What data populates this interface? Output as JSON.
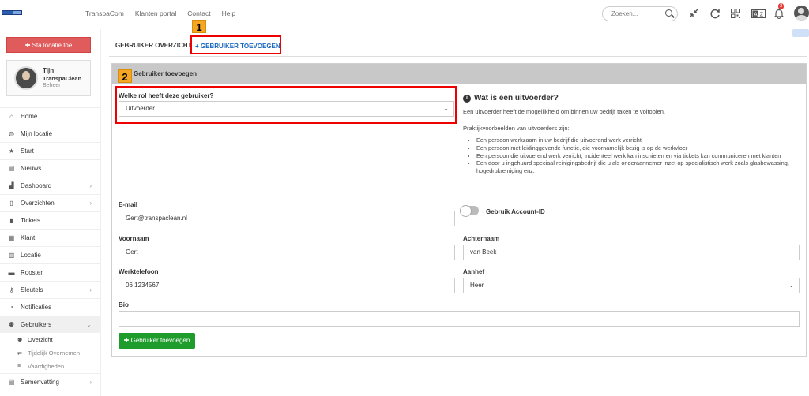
{
  "topbar": {
    "nav": [
      "TranspaCom",
      "Klanten portal",
      "Contact",
      "Help"
    ],
    "search_placeholder": "Zoeken...",
    "notification_count": "2",
    "icons": [
      "compress-icon",
      "refresh-icon",
      "qr-icon",
      "translate-icon",
      "bell-icon"
    ]
  },
  "sidebar": {
    "add_location_button": "✚ Sta locatie toe",
    "profile": {
      "name": "Tijn",
      "org": "TranspaClean",
      "role": "Beheer"
    },
    "items": [
      {
        "label": "Home",
        "icon": "home-icon",
        "glyph": "⌂"
      },
      {
        "label": "Mijn locatie",
        "icon": "globe-icon",
        "glyph": "◍"
      },
      {
        "label": "Start",
        "icon": "star-icon",
        "glyph": "★"
      },
      {
        "label": "Nieuws",
        "icon": "news-icon",
        "glyph": "▤"
      },
      {
        "label": "Dashboard",
        "icon": "chart-icon",
        "glyph": "📈",
        "chevron": true
      },
      {
        "label": "Overzichten",
        "icon": "file-icon",
        "glyph": "▯",
        "chevron": true
      },
      {
        "label": "Tickets",
        "icon": "comment-icon",
        "glyph": "▮"
      },
      {
        "label": "Klant",
        "icon": "building-icon",
        "glyph": "▦"
      },
      {
        "label": "Locatie",
        "icon": "location-building-icon",
        "glyph": "▥"
      },
      {
        "label": "Rooster",
        "icon": "calendar-icon",
        "glyph": "▬"
      },
      {
        "label": "Sleutels",
        "icon": "key-icon",
        "glyph": "⚷",
        "chevron": true
      },
      {
        "label": "Notificaties",
        "icon": "bell-icon",
        "glyph": "🔔"
      },
      {
        "label": "Gebruikers",
        "icon": "users-icon",
        "glyph": "👥",
        "chevron": true
      }
    ],
    "sub_items": [
      {
        "label": "Overzicht",
        "glyph": "👥"
      },
      {
        "label": "Tijdelijk Overnemen",
        "glyph": "⇄"
      },
      {
        "label": "Vaardigheden",
        "glyph": "≡"
      }
    ],
    "last_item": {
      "label": "Samenvatting",
      "glyph": "▤"
    }
  },
  "tabs": {
    "overview": "GEBRUIKER OVERZICHT",
    "add": "+ GEBRUIKER TOEVOEGEN"
  },
  "markers": [
    "1",
    "2"
  ],
  "panel": {
    "title": "Gebruiker toevoegen",
    "role_label": "Welke rol heeft deze gebruiker?",
    "role_value": "Uitvoerder",
    "info": {
      "title": "Wat is een uitvoerder?",
      "intro": "Een uitvoerder heeft de mogelijkheid om binnen uw bedrijf taken te voltooien.",
      "examples_heading": "Praktijkvoorbeelden van uitvoerders zijn:",
      "examples": [
        "Een persoon werkzaam in uw bedrijf die uitvoerend werk verricht",
        "Een persoon met leidinggevende functie, die voornamelijk bezig is op de werkvloer",
        "Een persoon die uitvoerend werk verricht, incidenteel werk kan inschieten en via tickets kan communiceren met klanten",
        "Een door u ingehuurd speciaal reinigingsbedrijf die u als onderaannemer inzet op specialistisch werk zoals glasbewassing, hogedrukreiniging enz."
      ]
    },
    "fields": {
      "email_label": "E-mail",
      "email_value": "Gert@transpaclean.nl",
      "account_toggle_label": "Gebruik Account-ID",
      "firstname_label": "Voornaam",
      "firstname_value": "Gert",
      "lastname_label": "Achternaam",
      "lastname_value": "van Beek",
      "phone_label": "Werktelefoon",
      "phone_value": "06 1234567",
      "salutation_label": "Aanhef",
      "salutation_value": "Heer",
      "bio_label": "Bio",
      "bio_value": ""
    },
    "submit": "✚ Gebruiker toevoegen"
  },
  "colors": {
    "accent_red": "#e05b5b",
    "highlight_box": "#ee0000",
    "marker": "#f5a623",
    "link_blue": "#1565c0",
    "submit_green": "#1e9d2d"
  }
}
